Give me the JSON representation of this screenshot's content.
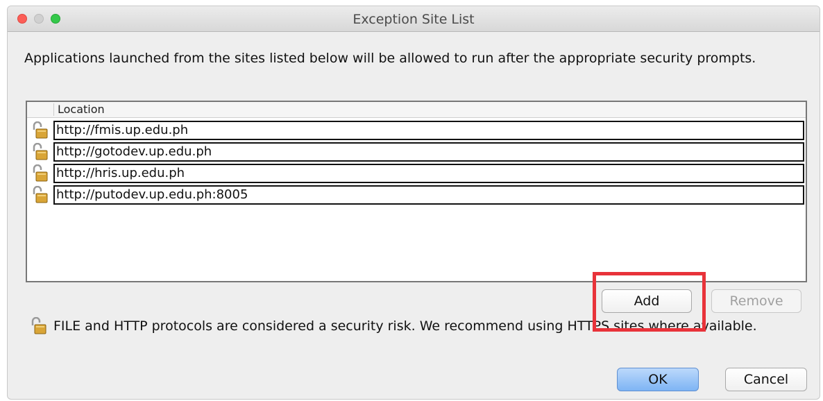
{
  "window": {
    "title": "Exception Site List"
  },
  "description": "Applications launched from the sites listed below will be allowed to run after the appropriate security prompts.",
  "table": {
    "column_header": "Location",
    "rows": [
      {
        "location": "http://fmis.up.edu.ph",
        "icon": "unlocked-padlock-icon"
      },
      {
        "location": "http://gotodev.up.edu.ph",
        "icon": "unlocked-padlock-icon"
      },
      {
        "location": "http://hris.up.edu.ph",
        "icon": "unlocked-padlock-icon"
      },
      {
        "location": "http://putodev.up.edu.ph:8005",
        "icon": "unlocked-padlock-icon"
      }
    ]
  },
  "buttons": {
    "add": "Add",
    "remove": "Remove",
    "ok": "OK",
    "cancel": "Cancel"
  },
  "warning": {
    "icon": "unlocked-padlock-icon",
    "text": "FILE and HTTP protocols are considered a security risk.  We recommend using HTTPS sites where available."
  },
  "colors": {
    "highlight": "#e8333a",
    "default_button": "#7eb4f4",
    "close": "#fc5e57",
    "maximize": "#34c84a"
  }
}
